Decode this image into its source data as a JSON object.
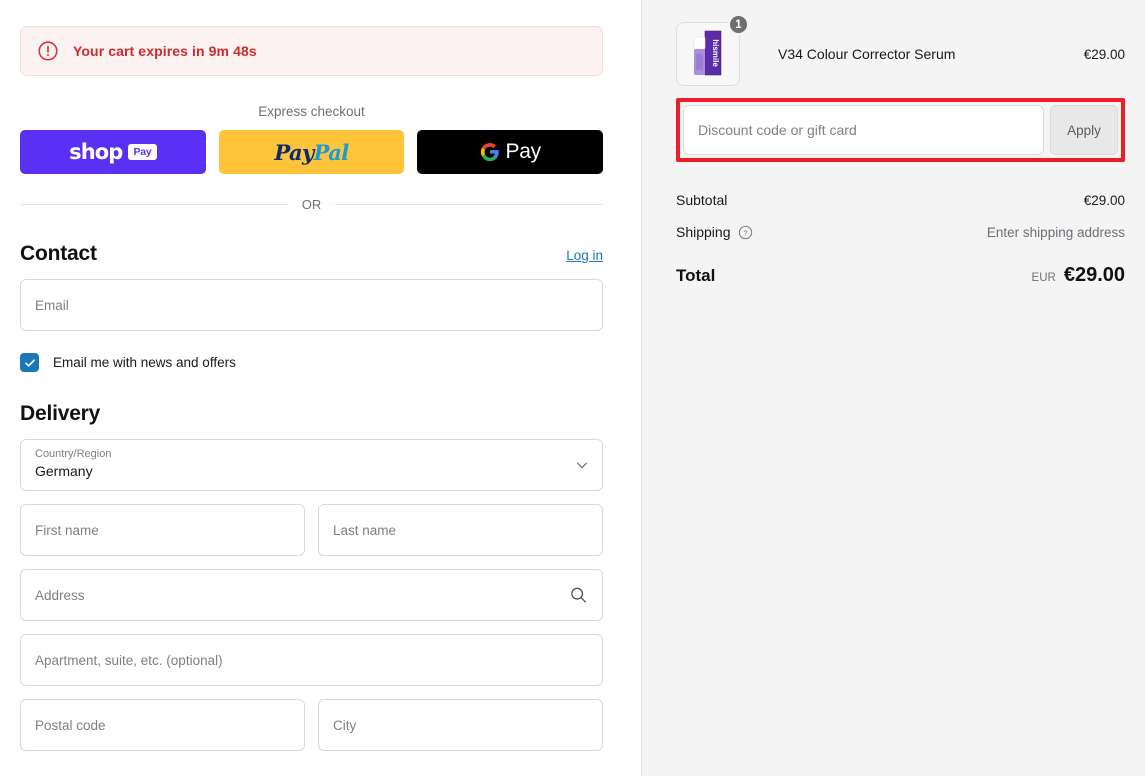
{
  "alert": {
    "icon": "alert-circle-icon",
    "text": "Your cart expires in 9m 48s",
    "color": "#cc2b2b",
    "background": "#fdf2f2"
  },
  "express": {
    "label": "Express checkout",
    "buttons": [
      {
        "id": "shop-pay",
        "word": "shop",
        "chip": "Pay",
        "color": "#5a31f4"
      },
      {
        "id": "paypal",
        "part1": "Pay",
        "part2": "Pal",
        "color": "#ffc43a"
      },
      {
        "id": "google-pay",
        "icon": "google-g-icon",
        "text": "Pay",
        "color": "#000000"
      }
    ],
    "divider_text": "OR"
  },
  "contact": {
    "title": "Contact",
    "login_label": "Log in",
    "email_placeholder": "Email",
    "email_value": "",
    "newsletter_label": "Email me with news and offers",
    "newsletter_checked": true
  },
  "delivery": {
    "title": "Delivery",
    "country": {
      "label": "Country/Region",
      "value": "Germany"
    },
    "fields": [
      {
        "name": "first-name",
        "placeholder": "First name",
        "value": "",
        "half": true
      },
      {
        "name": "last-name",
        "placeholder": "Last name",
        "value": "",
        "half": true
      },
      {
        "name": "address",
        "placeholder": "Address",
        "value": "",
        "half": false,
        "icon": "search-icon"
      },
      {
        "name": "apartment",
        "placeholder": "Apartment, suite, etc. (optional)",
        "value": "",
        "half": false
      },
      {
        "name": "postal-code",
        "placeholder": "Postal code",
        "value": "",
        "half": true
      },
      {
        "name": "city",
        "placeholder": "City",
        "value": "",
        "half": true
      }
    ]
  },
  "summary": {
    "item": {
      "name": "V34 Colour Corrector Serum",
      "price": "€29.00",
      "quantity": "1",
      "thumbnail_alt": "hismile V34 serum bottle"
    },
    "discount": {
      "placeholder": "Discount code or gift card",
      "value": "",
      "apply_label": "Apply",
      "highlight_color": "#ee1c25"
    },
    "rows": [
      {
        "label": "Subtotal",
        "value": "€29.00",
        "muted": false,
        "help": false
      },
      {
        "label": "Shipping",
        "value": "Enter shipping address",
        "muted": true,
        "help": true
      }
    ],
    "total": {
      "label": "Total",
      "currency": "EUR",
      "value": "€29.00"
    }
  }
}
